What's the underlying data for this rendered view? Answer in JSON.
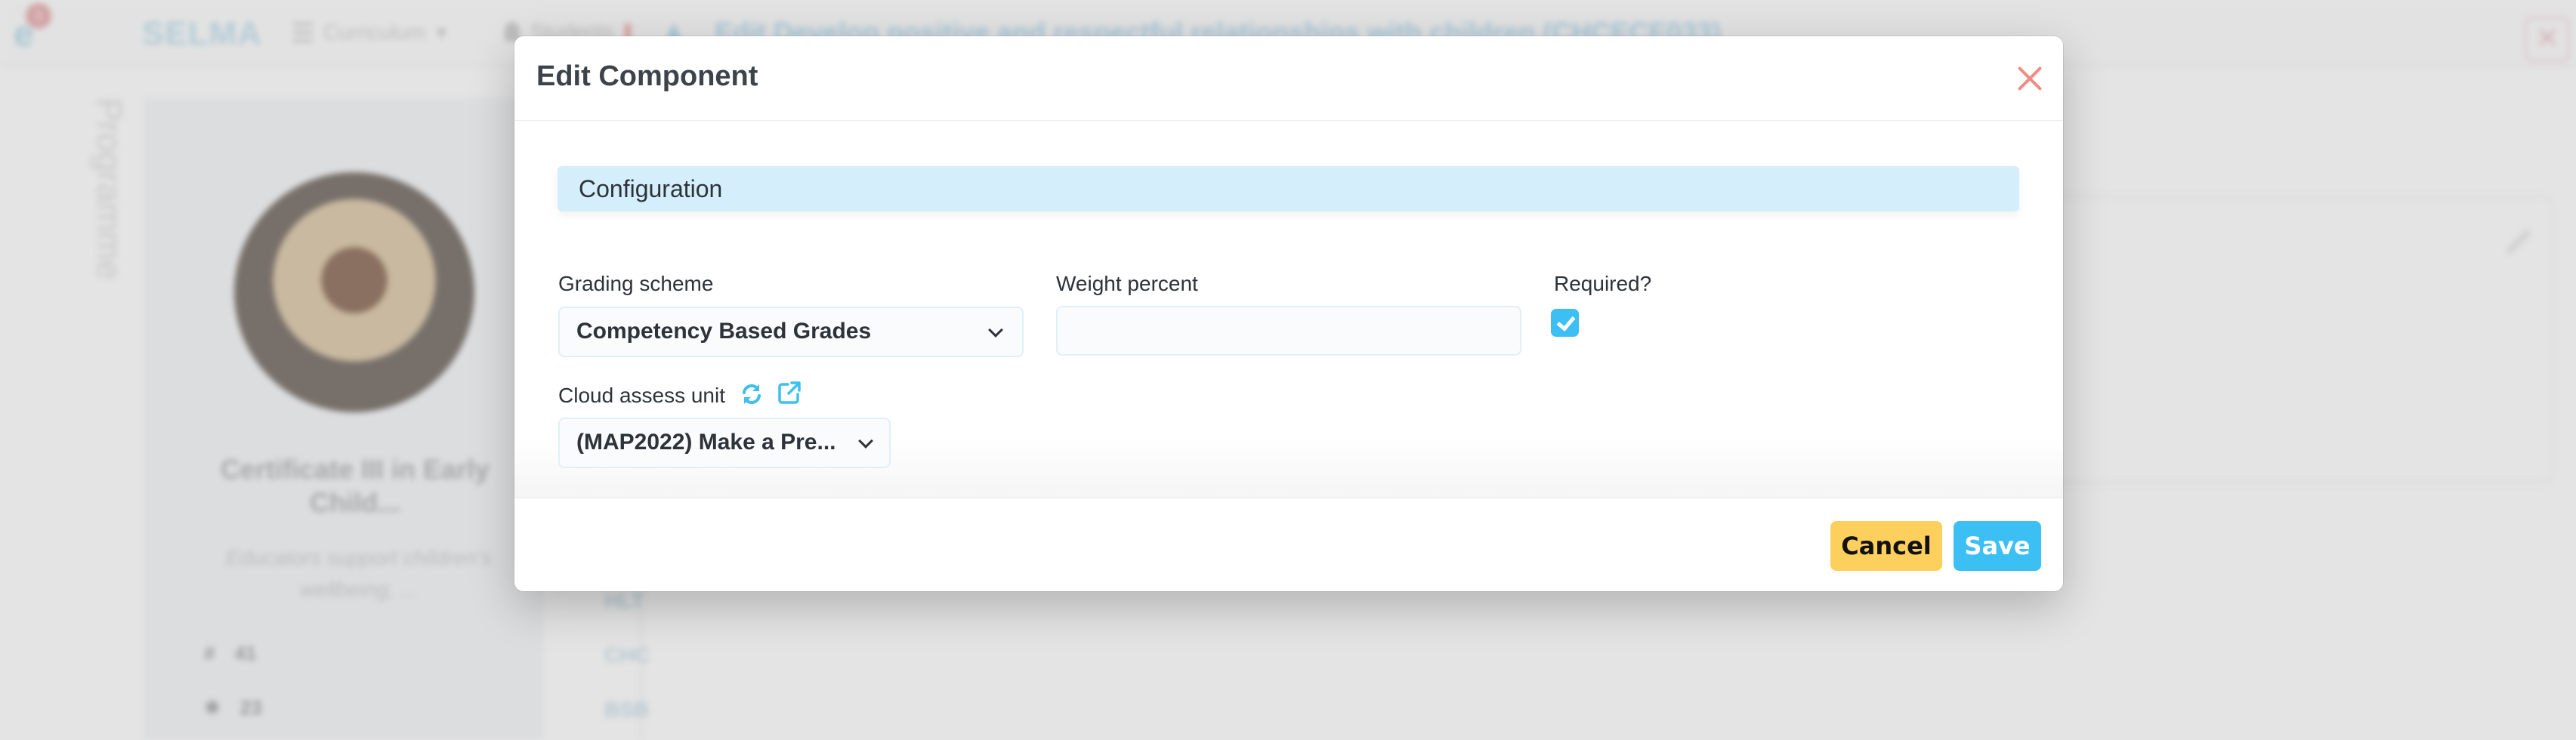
{
  "background": {
    "brand": "SELMA",
    "notification_count": "3",
    "nav": [
      {
        "label": "Curriculum",
        "icon": "menu-icon",
        "has_dropdown": true
      },
      {
        "label": "Students",
        "icon": "user-icon",
        "has_dropdown": false
      }
    ],
    "page_title": "Edit Develop positive and respectful relationships with children (CHCECE033)",
    "side_tab": "Programme",
    "programme": {
      "title": "Certificate III in Early Child...",
      "description": "Educators support children's wellbeing, ...",
      "stats": [
        {
          "icon": "hash-icon",
          "value": "41"
        },
        {
          "icon": "puzzle-icon",
          "value": "23"
        }
      ]
    },
    "unit_codes": [
      "HLT",
      "CHC",
      "BSB"
    ],
    "close_glyph": "✕"
  },
  "modal": {
    "title": "Edit Component",
    "section_title": "Configuration",
    "fields": {
      "grading_scheme": {
        "label": "Grading scheme",
        "value": "Competency Based Grades"
      },
      "weight_percent": {
        "label": "Weight percent",
        "value": ""
      },
      "required": {
        "label": "Required?",
        "checked": true
      },
      "cloud_assess_unit": {
        "label": "Cloud assess unit",
        "value": "(MAP2022) Make a Pre..."
      }
    },
    "buttons": {
      "cancel": "Cancel",
      "save": "Save"
    }
  },
  "colors": {
    "accent": "#3cbff3",
    "section_bg": "#d4eefb",
    "cancel_bg": "#fdd05d",
    "close_icon": "#f28b82",
    "text": "#2d3339"
  }
}
